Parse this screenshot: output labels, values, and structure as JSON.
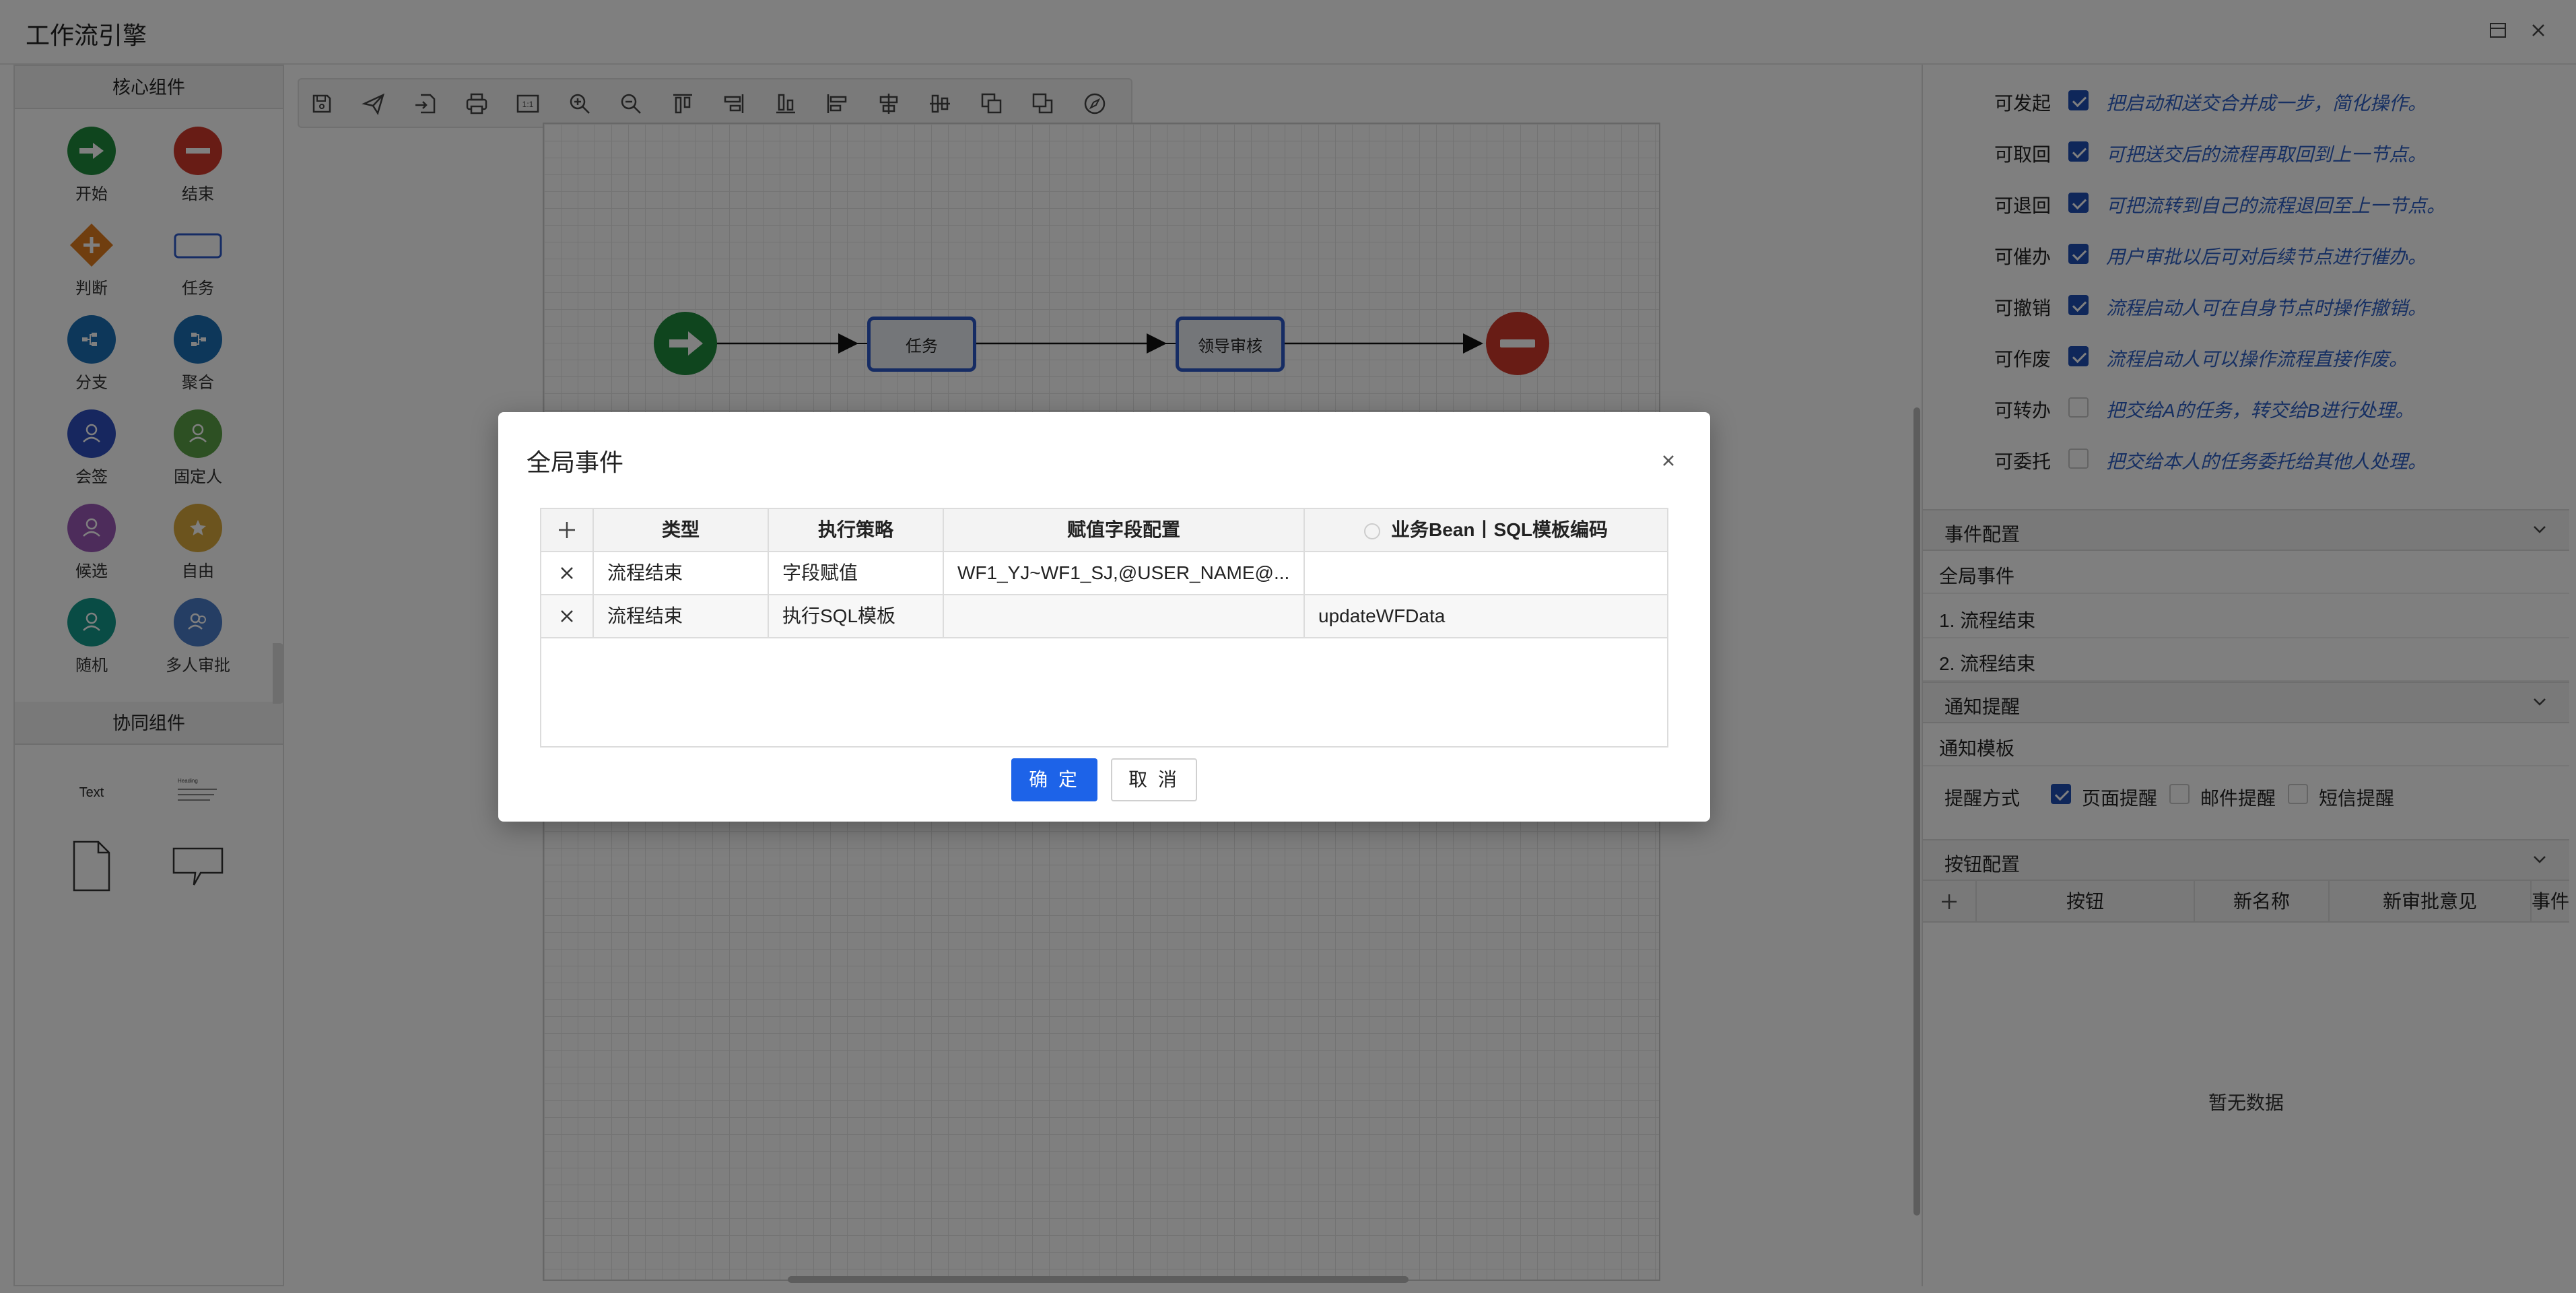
{
  "app": {
    "title": "工作流引擎"
  },
  "palette": {
    "core_header": "核心组件",
    "core_items": [
      {
        "label": "开始",
        "icon": "arrow-right-icon",
        "color": "#1e8a3c"
      },
      {
        "label": "结束",
        "icon": "minus-icon",
        "color": "#d0392b"
      },
      {
        "label": "判断",
        "icon": "plus-diamond-icon",
        "color": "#e07c1f"
      },
      {
        "label": "任务",
        "icon": "task-rect-icon",
        "color": "#2d58c9"
      },
      {
        "label": "分支",
        "icon": "branch-icon",
        "color": "#1a6fb5"
      },
      {
        "label": "聚合",
        "icon": "merge-icon",
        "color": "#1a6fb5"
      },
      {
        "label": "会签",
        "icon": "user-icon",
        "color": "#2e4fbf"
      },
      {
        "label": "固定人",
        "icon": "user-icon",
        "color": "#5aa147"
      },
      {
        "label": "候选",
        "icon": "user-icon",
        "color": "#9b59b6"
      },
      {
        "label": "自由",
        "icon": "star-icon",
        "color": "#d9a83c"
      },
      {
        "label": "随机",
        "icon": "user-icon",
        "color": "#13988a"
      },
      {
        "label": "多人审批",
        "icon": "users-icon",
        "color": "#4b7cc8"
      }
    ],
    "collab_header": "协同组件",
    "collab_items": [
      {
        "label": "Text",
        "icon": "text-icon"
      },
      {
        "label": "Heading",
        "icon": "heading-icon"
      },
      {
        "label": "",
        "icon": "document-icon"
      },
      {
        "label": "",
        "icon": "callout-icon"
      }
    ]
  },
  "canvas": {
    "toolbar_icons": [
      "save-icon",
      "send-icon",
      "import-icon",
      "print-icon",
      "actual-size-icon",
      "zoom-in-icon",
      "zoom-out-icon",
      "align-top-icon",
      "align-right-icon",
      "align-bottom-icon",
      "align-left-icon",
      "align-center-icon",
      "align-middle-icon",
      "copy-icon",
      "bring-front-icon",
      "compass-icon"
    ],
    "actual_size_label": "1:1",
    "nodes": {
      "task": "任务",
      "leader_review": "领导审核"
    }
  },
  "properties": {
    "permissions": [
      {
        "label": "可发起",
        "checked": true,
        "desc": "把启动和送交合并成一步，简化操作。"
      },
      {
        "label": "可取回",
        "checked": true,
        "desc": "可把送交后的流程再取回到上一节点。"
      },
      {
        "label": "可退回",
        "checked": true,
        "desc": "可把流转到自己的流程退回至上一节点。"
      },
      {
        "label": "可催办",
        "checked": true,
        "desc": "用户审批以后可对后续节点进行催办。"
      },
      {
        "label": "可撤销",
        "checked": true,
        "desc": "流程启动人可在自身节点时操作撤销。"
      },
      {
        "label": "可作废",
        "checked": true,
        "desc": "流程启动人可以操作流程直接作废。"
      },
      {
        "label": "可转办",
        "checked": false,
        "desc": "把交给A的任务，转交给B进行处理。"
      },
      {
        "label": "可委托",
        "checked": false,
        "desc": "把交给本人的任务委托给其他人处理。"
      }
    ],
    "event_section": {
      "title": "事件配置",
      "global_label": "全局事件",
      "items": [
        "1. 流程结束",
        "2. 流程结束"
      ]
    },
    "notify_section": {
      "title": "通知提醒",
      "template_label": "通知模板",
      "method_label": "提醒方式",
      "options": [
        {
          "label": "页面提醒",
          "checked": true
        },
        {
          "label": "邮件提醒",
          "checked": false
        },
        {
          "label": "短信提醒",
          "checked": false
        }
      ]
    },
    "button_section": {
      "title": "按钮配置",
      "columns": [
        "按钮",
        "新名称",
        "新审批意见",
        "事件"
      ],
      "empty_text": "暂无数据"
    }
  },
  "modal": {
    "title": "全局事件",
    "columns": [
      "类型",
      "执行策略",
      "赋值字段配置",
      "业务Bean丨SQL模板编码"
    ],
    "rows": [
      {
        "type": "流程结束",
        "strategy": "字段赋值",
        "assign": "WF1_YJ~WF1_SJ,@USER_NAME@...",
        "bean": ""
      },
      {
        "type": "流程结束",
        "strategy": "执行SQL模板",
        "assign": "",
        "bean": "updateWFData"
      }
    ],
    "confirm_label": "确 定",
    "cancel_label": "取 消"
  },
  "colors": {
    "accent": "#1d63e8",
    "task_border": "#2d58c9",
    "desc_text": "#2d5fc4"
  }
}
